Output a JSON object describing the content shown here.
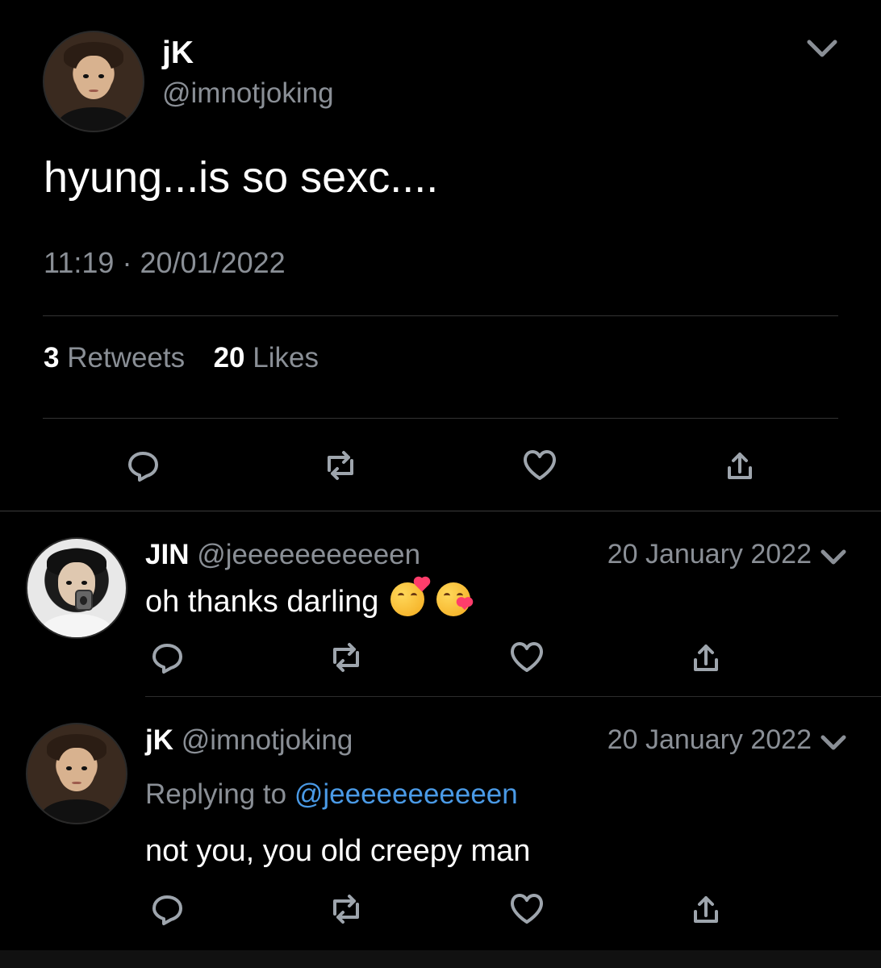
{
  "main_tweet": {
    "author_name": "jK",
    "author_handle": "@imnotjoking",
    "text": "hyung...is so sexc....",
    "timestamp": "11:19",
    "separator": "·",
    "date": "20/01/2022",
    "retweets_count": "3",
    "retweets_label": "Retweets",
    "likes_count": "20",
    "likes_label": "Likes",
    "menu_icon": "chevron-down-icon"
  },
  "replies": [
    {
      "author_name": "JIN",
      "author_handle": "@jeeeeeeeeeeen",
      "date": "20 January 2022",
      "text": "oh thanks darling",
      "emojis": [
        "smiling-face-with-hearts-icon",
        "face-blowing-kiss-icon"
      ]
    },
    {
      "author_name": "jK",
      "author_handle": "@imnotjoking",
      "date": "20 January 2022",
      "replying_to_label": "Replying to",
      "replying_to_handle": "@jeeeeeeeeeeen",
      "text": "not you, you old creepy man"
    }
  ],
  "icons": [
    "reply-icon",
    "retweet-icon",
    "like-icon",
    "share-icon",
    "chevron-down-icon"
  ],
  "colors": {
    "background": "#000000",
    "text": "#ffffff",
    "muted": "#8a8f96",
    "link": "#4a9ae6",
    "divider": "#333333"
  }
}
